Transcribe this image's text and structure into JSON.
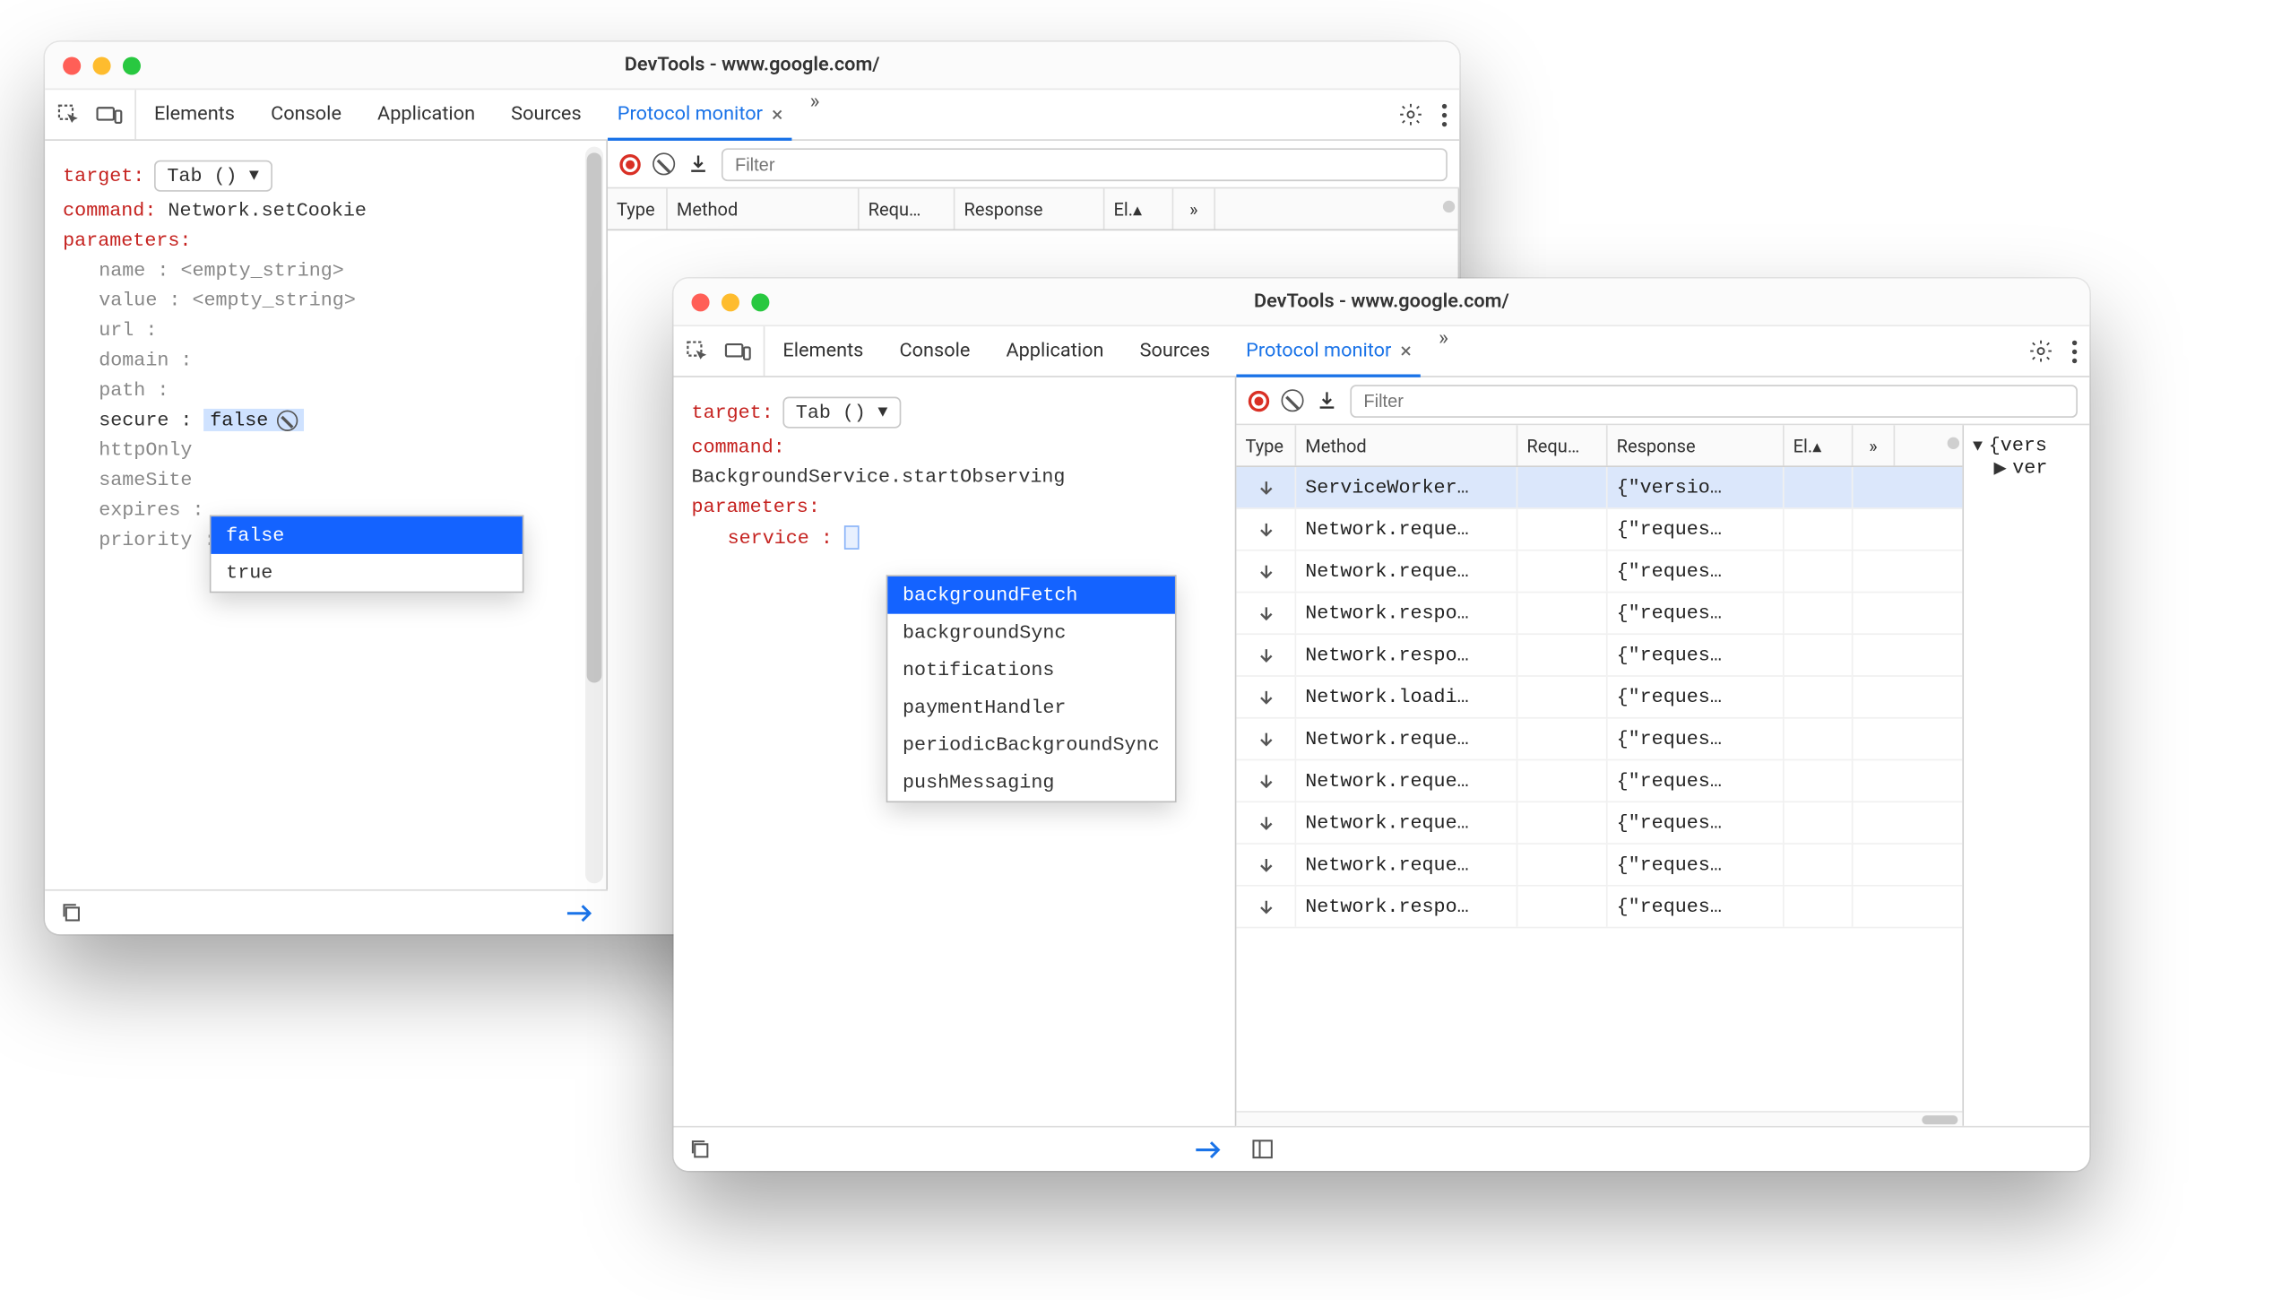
{
  "windows": {
    "back": {
      "title": "DevTools - www.google.com/",
      "tabs": [
        "Elements",
        "Console",
        "Application",
        "Sources",
        "Protocol monitor"
      ],
      "active_tab": "Protocol monitor",
      "left": {
        "target_label": "target:",
        "target_value": "Tab ()",
        "command_label": "command:",
        "command_value": "Network.setCookie",
        "parameters_label": "parameters:",
        "params": {
          "name": "name :",
          "value": "value :",
          "url": "url :",
          "domain": "domain :",
          "path": "path :",
          "secure": "secure :",
          "httpOnly": "httpOnly",
          "sameSite": "sameSite",
          "expires": "expires :",
          "priority": "priority :"
        },
        "empty_string": "<empty_string>",
        "secure_value": "false",
        "dropdown": [
          "false",
          "true"
        ],
        "selected_dropdown": "false"
      },
      "right": {
        "filter_placeholder": "Filter",
        "columns": {
          "type": "Type",
          "method": "Method",
          "request": "Requ…",
          "response": "Response",
          "elapsed": "El.▴"
        }
      }
    },
    "front": {
      "title": "DevTools - www.google.com/",
      "tabs": [
        "Elements",
        "Console",
        "Application",
        "Sources",
        "Protocol monitor"
      ],
      "active_tab": "Protocol monitor",
      "left": {
        "target_label": "target:",
        "target_value": "Tab ()",
        "command_label": "command:",
        "command_value": "BackgroundService.startObserving",
        "parameters_label": "parameters:",
        "params": {
          "service": "service :"
        },
        "dropdown": [
          "backgroundFetch",
          "backgroundSync",
          "notifications",
          "paymentHandler",
          "periodicBackgroundSync",
          "pushMessaging"
        ],
        "selected_dropdown": "backgroundFetch"
      },
      "right": {
        "filter_placeholder": "Filter",
        "columns": {
          "type": "Type",
          "method": "Method",
          "request": "Requ…",
          "response": "Response",
          "elapsed": "El.▴"
        },
        "rows": [
          {
            "method": "ServiceWorker…",
            "response": "{\"versio…",
            "selected": true
          },
          {
            "method": "Network.reque…",
            "response": "{\"reques…"
          },
          {
            "method": "Network.reque…",
            "response": "{\"reques…"
          },
          {
            "method": "Network.respo…",
            "response": "{\"reques…"
          },
          {
            "method": "Network.respo…",
            "response": "{\"reques…"
          },
          {
            "method": "Network.loadi…",
            "response": "{\"reques…"
          },
          {
            "method": "Network.reque…",
            "response": "{\"reques…"
          },
          {
            "method": "Network.reque…",
            "response": "{\"reques…"
          },
          {
            "method": "Network.reque…",
            "response": "{\"reques…"
          },
          {
            "method": "Network.reque…",
            "response": "{\"reques…"
          },
          {
            "method": "Network.respo…",
            "response": "{\"reques…"
          }
        ],
        "side": {
          "root": "{vers",
          "child": "ver"
        }
      }
    }
  }
}
